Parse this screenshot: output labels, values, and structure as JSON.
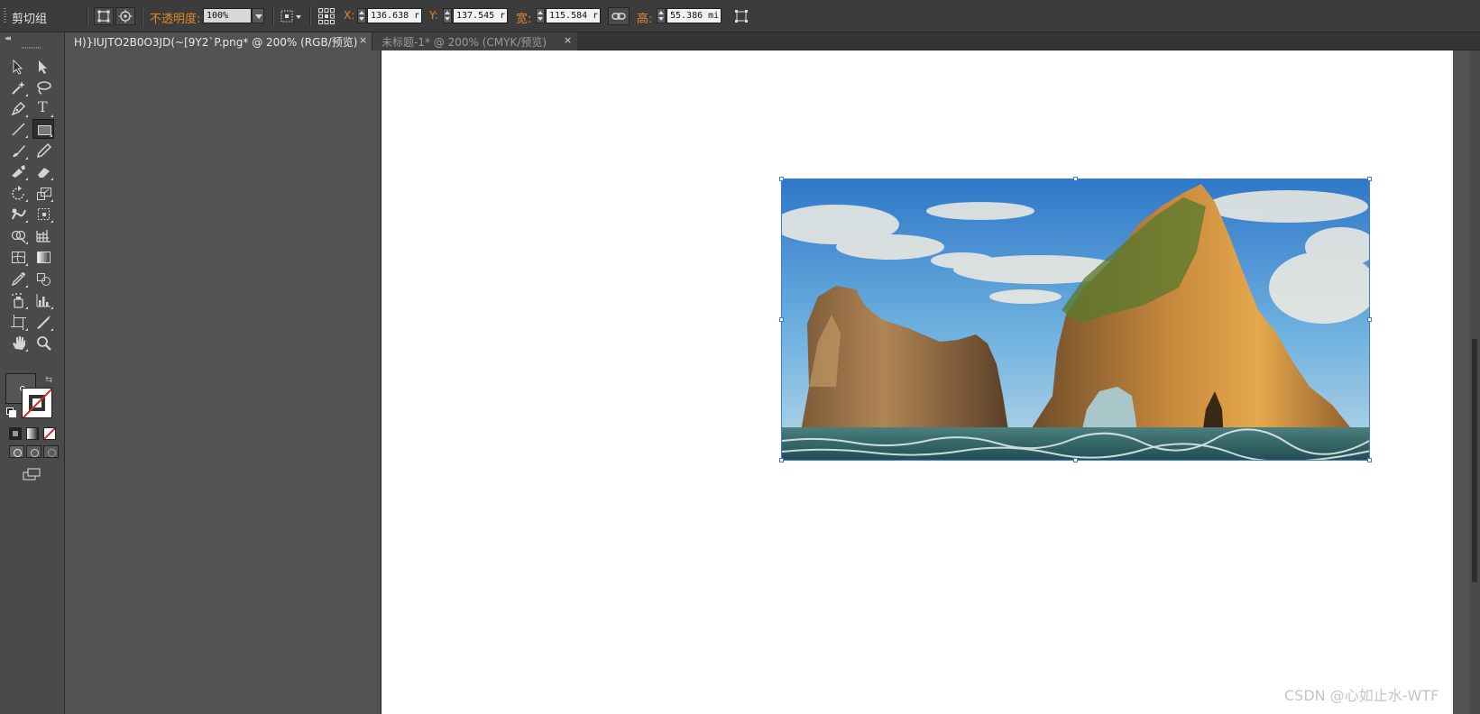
{
  "control_bar": {
    "group_label": "剪切组",
    "opacity_label": "不透明度:",
    "opacity_value": "100%",
    "x_label": "X:",
    "x_value": "136.638 r",
    "y_label": "Y:",
    "y_value": "137.545 r",
    "width_label": "宽:",
    "width_value": "115.584 r",
    "height_label": "高:",
    "height_value": "55.386 mi"
  },
  "tabs": [
    {
      "label": "H)}IUJTO2B0O3JD(~[9Y2`P.png* @ 200% (RGB/预览)",
      "close": "×",
      "active": true
    },
    {
      "label": "未标题-1* @ 200% (CMYK/预览)",
      "close": "×",
      "active": false
    }
  ],
  "toolbox": {
    "collapse": "◂◂",
    "tools": [
      "selection-tool",
      "direct-selection-tool",
      "magic-wand-tool",
      "lasso-tool",
      "pen-tool",
      "type-tool",
      "line-tool",
      "rectangle-tool",
      "paintbrush-tool",
      "pencil-tool",
      "blob-brush-tool",
      "eraser-tool",
      "rotate-tool",
      "scale-tool",
      "warp-tool",
      "free-transform-tool",
      "shape-builder-tool",
      "perspective-grid-tool",
      "mesh-tool",
      "gradient-tool",
      "eyedropper-tool",
      "blend-tool",
      "symbol-sprayer-tool",
      "column-graph-tool",
      "artboard-tool",
      "slice-tool",
      "hand-tool",
      "zoom-tool"
    ],
    "type_glyph": "T"
  },
  "colors": {
    "selection": "#3d7bd8",
    "label_orange": "#e0892a",
    "ui_dark": "#3c3c3c",
    "pasteboard": "#535353",
    "artboard": "#ffffff"
  },
  "watermark": "CSDN @心如止水-WTF"
}
